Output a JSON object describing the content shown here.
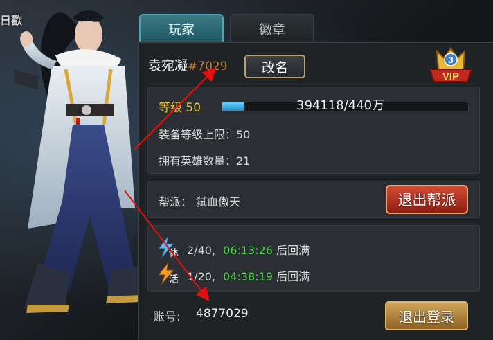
{
  "corner_text": "日歡",
  "tabs": [
    {
      "label": "玩家",
      "active": true
    },
    {
      "label": "徽章",
      "active": false
    }
  ],
  "player": {
    "name": "袁宛凝",
    "id_tag": "#7029",
    "rename_button": "改名",
    "vip_level": "3",
    "vip_text": "VIP"
  },
  "stats": {
    "level_label": "等级 50",
    "exp_text": "394118/440万",
    "exp_fraction": 0.09,
    "equip_limit": "装备等级上限：50",
    "hero_count": "拥有英雄数量：21"
  },
  "guild": {
    "label": "帮派：",
    "name": "弑血傲天",
    "quit_button": "退出帮派"
  },
  "resources": [
    {
      "icon": "rest-lightning-icon",
      "glyph": "休",
      "count": "2/40,",
      "time": "06:13:26",
      "suffix": "后回满",
      "icon_color": "#5fb8f0"
    },
    {
      "icon": "vitality-lightning-icon",
      "glyph": "活",
      "count": "1/20,",
      "time": "04:38:19",
      "suffix": "后回满",
      "icon_color": "#f09a2a"
    }
  ],
  "account": {
    "label": "账号:",
    "value": "4877029",
    "logout_button": "退出登录"
  },
  "colors": {
    "level": "#e6c12f",
    "time": "#4cd646",
    "id_tag": "#c07a36",
    "annotation_arrow": "#e01010"
  }
}
